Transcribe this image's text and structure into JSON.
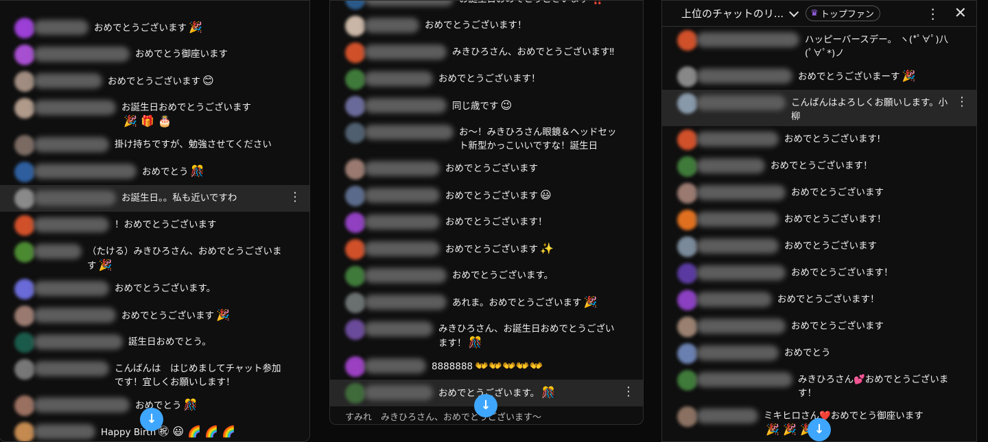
{
  "header": {
    "title": "上位のチャットのリ...",
    "chip_label": "トップファン",
    "chip_icon": "crown-icon",
    "more_icon": "⋮",
    "close_icon": "✕"
  },
  "scroll_button_icon": "↓",
  "colors": {
    "accent": "#3ea6ff",
    "highlight_row": "#272727",
    "background": "#0f0f0f"
  },
  "panels": [
    {
      "messages": [
        {
          "text": "おめでとうございます",
          "emoji": "🎉"
        },
        {
          "text": "おめでとう御座います",
          "emoji": ""
        },
        {
          "text": "おめでとうございます",
          "emoji": "😊"
        },
        {
          "text": "お誕生日おめでとうございます",
          "emoji": "🎉 🎁 🎂"
        },
        {
          "text": "掛け持ちですが、勉強させてください",
          "emoji": ""
        },
        {
          "text": "おめでとう",
          "emoji": "🎊"
        },
        {
          "text": "お誕生日。。私も近いですわ",
          "emoji": "",
          "highlight": true
        },
        {
          "text": "！おめでとうございます",
          "emoji": ""
        },
        {
          "text": "（たける）みきひろさん、おめでとうございます",
          "emoji": "🎉"
        },
        {
          "text": "おめでとうございます。",
          "emoji": ""
        },
        {
          "text": "おめでとうございます",
          "emoji": "🎉"
        },
        {
          "text": "誕生日おめでとう。",
          "emoji": ""
        },
        {
          "text": "こんばんは　はじめましてチャット参加です！宜しくお願いします！",
          "emoji": ""
        },
        {
          "text": "おめでとう",
          "emoji": "🎊"
        },
        {
          "text": "Happy Birth",
          "emoji": "㊗ 😃 🌈 🌈 🌈"
        }
      ]
    },
    {
      "messages": [
        {
          "text": "お誕生日おめでとうございます",
          "emoji": "‼️"
        },
        {
          "text": "おめでとうございます！",
          "emoji": ""
        },
        {
          "text": "みきひろさん、おめでとうございます‼",
          "emoji": ""
        },
        {
          "text": "おめでとうございます！",
          "emoji": ""
        },
        {
          "text": "同じ歳です",
          "emoji": "😉"
        },
        {
          "text": "お〜！みきひろさん眼鏡＆ヘッドセット新型かっこいいですな！誕生日",
          "emoji": ""
        },
        {
          "text": "おめでとうございます",
          "emoji": ""
        },
        {
          "text": "おめでとうございます",
          "emoji": "😃"
        },
        {
          "text": "おめでとうございます！",
          "emoji": ""
        },
        {
          "text": "おめでとうございます",
          "emoji": "✨"
        },
        {
          "text": "おめでとうございます。",
          "emoji": ""
        },
        {
          "text": "あれま。おめでとうございます",
          "emoji": "🎉"
        },
        {
          "text": "みきひろさん、お誕生日おめでとうございます！",
          "emoji": "🎊"
        },
        {
          "text": "8888888",
          "emoji": "👐👐👐👐👐"
        },
        {
          "text": "おめでとうございます。",
          "emoji": "🎊",
          "highlight": true
        }
      ],
      "partial_text": "すみれ　みきひろさん、おめでとうございます〜"
    },
    {
      "messages": [
        {
          "text": "おめでとう",
          "emoji": ""
        },
        {
          "text": "ハッピーバースデー。 ヽ(*ﾟ∀ﾟ)八(ﾟ∀ﾟ*)ノ",
          "emoji": ""
        },
        {
          "text": "おめでとうございまーす",
          "emoji": "🎉"
        },
        {
          "text": "こんばんはよろしくお願いします。小柳",
          "emoji": "",
          "highlight": true
        },
        {
          "text": "おめでとうございます!",
          "emoji": ""
        },
        {
          "text": "おめでとうございます！",
          "emoji": ""
        },
        {
          "text": "おめでとうございます",
          "emoji": ""
        },
        {
          "text": "おめでとうございます！",
          "emoji": ""
        },
        {
          "text": "おめでとうございます",
          "emoji": ""
        },
        {
          "text": "おめでとうございます！",
          "emoji": ""
        },
        {
          "text": "おめでとうございます！",
          "emoji": ""
        },
        {
          "text": "おめでとうございます",
          "emoji": ""
        },
        {
          "text": "おめでとう",
          "emoji": ""
        },
        {
          "text": "みきひろさん💕おめでとうございます！",
          "emoji": ""
        },
        {
          "text": "ミキヒロさん❤️おめでとう御座います",
          "emoji": "🎉 🎉 🎉"
        }
      ]
    }
  ]
}
